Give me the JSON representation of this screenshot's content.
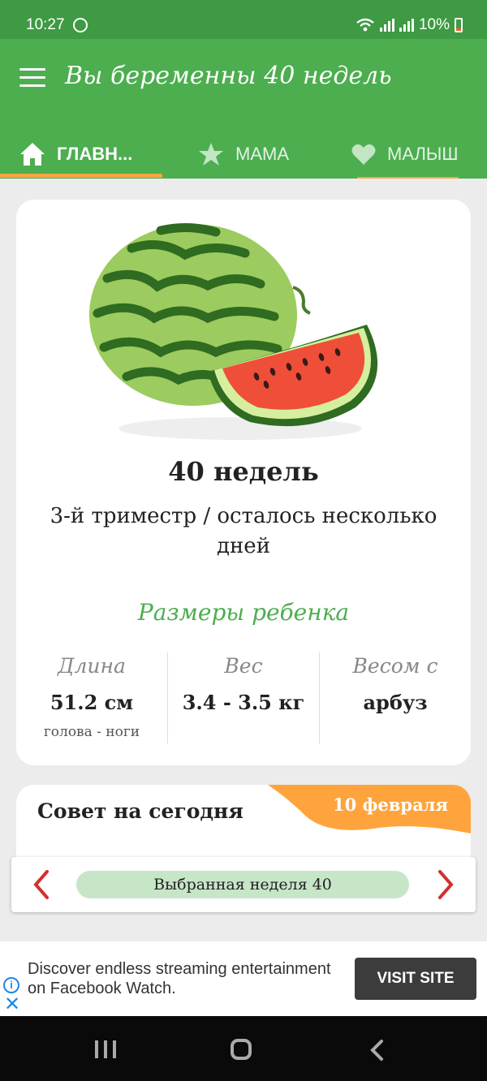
{
  "status_bar": {
    "time": "10:27",
    "battery": "10%",
    "battery_color": "#ff5b3a"
  },
  "app_bar": {
    "title": "Вы беременны 40 недель",
    "tabs": [
      {
        "label": "ГЛАВН...",
        "icon": "home-icon",
        "selected": true
      },
      {
        "label": "МАМА",
        "icon": "star-icon",
        "selected": false
      },
      {
        "label": "МАЛЫШ",
        "icon": "heart-icon",
        "selected": false
      }
    ],
    "color": "#4cae4f",
    "indicator_color": "#ffa43d"
  },
  "week_card": {
    "image": "watermelon-image",
    "title": "40 недель",
    "subtitle": "3-й триместр / осталось несколько дней",
    "sizes_title": "Размеры ребенка",
    "stats": [
      {
        "label": "Длина",
        "value": "51.2 см",
        "sub": "голова - ноги"
      },
      {
        "label": "Вес",
        "value": "3.4 - 3.5 кг",
        "sub": ""
      },
      {
        "label": "Весом с",
        "value": "арбуз",
        "sub": ""
      }
    ]
  },
  "tip_card": {
    "title": "Совет на сегодня",
    "date": "10 февраля",
    "banner_color": "#ffa43d"
  },
  "week_nav": {
    "label": "Выбранная неделя 40",
    "arrow_color": "#d32f2f"
  },
  "ad": {
    "text": "Discover endless streaming entertainment on Facebook Watch.",
    "button": "VISIT SITE"
  }
}
